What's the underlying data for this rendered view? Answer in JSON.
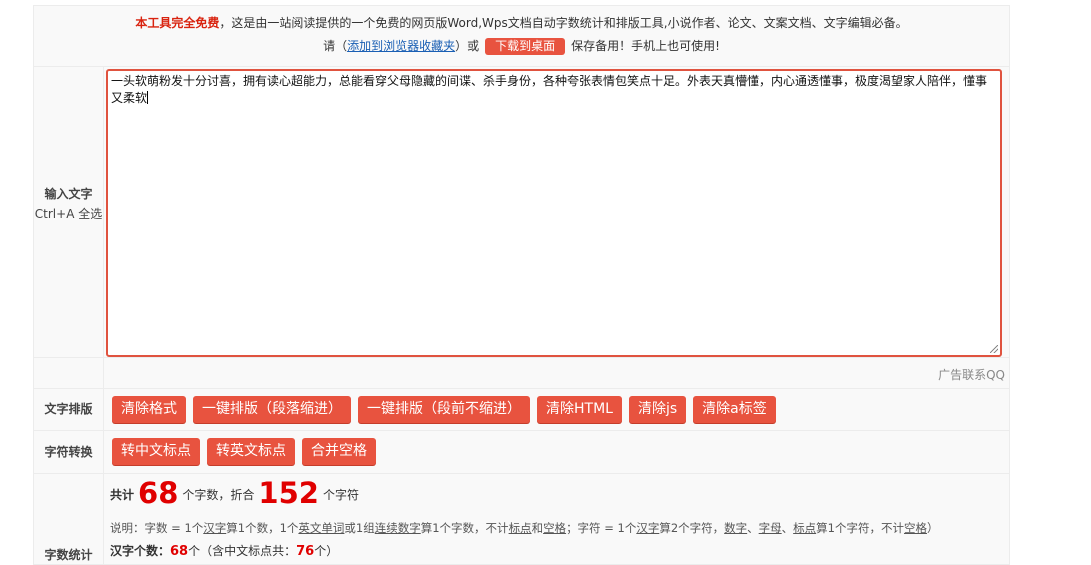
{
  "header": {
    "free_label": "本工具完全免费",
    "intro": "，这是由一站阅读提供的一个免费的网页版Word,Wps文档自动字数统计和排版工具,小说作者、论文、文案文档、文字编辑必备。",
    "please": "请（",
    "bookmark_link": "添加到浏览器收藏夹",
    "or": "）或",
    "download_label": "下载到桌面",
    "save_note": "保存备用！手机上也可使用!"
  },
  "input": {
    "label": "输入文字",
    "hint": "Ctrl+A 全选",
    "text": "一头软萌粉发十分讨喜，拥有读心超能力，总能看穿父母隐藏的间谍、杀手身份，各种夸张表情包笑点十足。外表天真懵懂，内心通透懂事，极度渴望家人陪伴，懂事又柔软"
  },
  "ad": {
    "text": "广告联系QQ"
  },
  "layout_row": {
    "label": "文字排版",
    "buttons": [
      "清除格式",
      "一键排版（段落缩进）",
      "一键排版（段前不缩进）",
      "清除HTML",
      "清除js",
      "清除a标签"
    ]
  },
  "convert_row": {
    "label": "字符转换",
    "buttons": [
      "转中文标点",
      "转英文标点",
      "合并空格"
    ]
  },
  "stats": {
    "label": "字数统计",
    "total_prefix": "共计",
    "word_count": "68",
    "word_unit": "个字数，折合",
    "char_count": "152",
    "char_unit": "个字符",
    "note_a": "说明：字数 = 1个",
    "note_hanzi": "汉字",
    "note_b": "算1个数，1个",
    "note_word": "英文单词",
    "note_c": "或1组",
    "note_digits": "连续数字",
    "note_d": "算1个字数，不计",
    "note_punct": "标点",
    "note_e": "和",
    "note_space": "空格",
    "note_f": "；字符 = 1个",
    "note_hanzi2": "汉字",
    "note_g": "算2个字符，",
    "note_num": "数字",
    "note_h": "、",
    "note_letter": "字母",
    "note_i": "、",
    "note_punct2": "标点",
    "note_j": "算1个字符，不计",
    "note_space2": "空格",
    "note_k": "）",
    "hanzi_label": "汉字个数：",
    "hanzi_count": "68",
    "hanzi_unit": "个（含中文标点共：",
    "hanzi_punct_count": "76",
    "hanzi_tail": "个）"
  }
}
